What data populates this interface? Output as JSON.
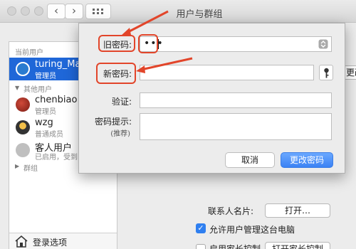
{
  "window": {
    "title": "用户与群组"
  },
  "sidebar": {
    "current_users_header": "当前用户",
    "other_users_header": "其他用户",
    "groups_label": "群组",
    "login_options_label": "登录选项",
    "current_user": {
      "name": "turing_Mac",
      "role": "管理员"
    },
    "other_users": [
      {
        "name": "chenbiao",
        "role": "管理员"
      },
      {
        "name": "wzg",
        "role": "普通成员"
      },
      {
        "name": "客人用户",
        "role": "已启用，受到"
      }
    ]
  },
  "main": {
    "contact_card_label": "联系人名片:",
    "open_button": "打开…",
    "allow_admin_label": "允许用户管理这台电脑",
    "parental_label": "启用家长控制",
    "open_parental_button": "打开家长控制",
    "change_pw_partial": "更改"
  },
  "dialog": {
    "old_password_label": "旧密码:",
    "old_password_value": "•••",
    "new_password_label": "新密码:",
    "verify_label": "验证:",
    "hint_label": "密码提示:",
    "hint_sublabel": "(推荐)",
    "cancel_button": "取消",
    "change_password_button": "更改密码"
  },
  "colors": {
    "accent": "#3b82f4",
    "annotation": "#e2452a",
    "selection": "#1f67d8"
  }
}
